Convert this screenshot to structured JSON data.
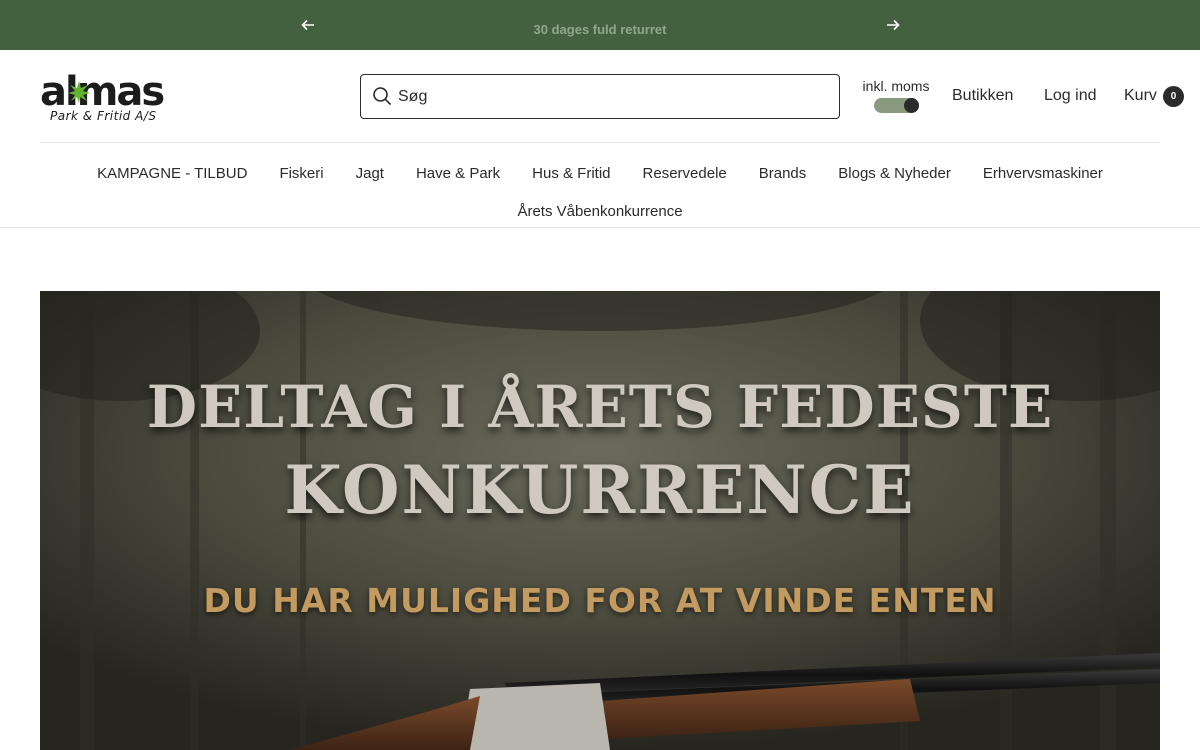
{
  "announcement": {
    "message": "30 dages fuld returret",
    "prev_icon": "arrow-left-icon",
    "next_icon": "arrow-right-icon"
  },
  "logo": {
    "name": "almas",
    "subtitle": "Park & Fritid A/S"
  },
  "search": {
    "placeholder": "Søg",
    "value": "",
    "icon": "search-icon"
  },
  "vat_toggle": {
    "label": "inkl. moms",
    "enabled": true
  },
  "header_links": {
    "store": "Butikken",
    "login": "Log ind",
    "cart": "Kurv",
    "cart_count": "0"
  },
  "nav": {
    "row1": [
      "KAMPAGNE - TILBUD",
      "Fiskeri",
      "Jagt",
      "Have & Park",
      "Hus & Fritid",
      "Reservedele",
      "Brands",
      "Blogs & Nyheder",
      "Erhvervsmaskiner"
    ],
    "row2": [
      "Årets Våbenkonkurrence"
    ]
  },
  "hero": {
    "line1": "DELTAG I ÅRETS FEDESTE",
    "line2": "KONKURRENCE",
    "line3": "DU HAR MULIGHED FOR AT VINDE ENTEN"
  },
  "colors": {
    "announcement_bg": "#43603f",
    "announcement_text": "#8ea98a",
    "toggle_track": "#8a9a7e",
    "hero_subtitle": "#c39a5f"
  }
}
